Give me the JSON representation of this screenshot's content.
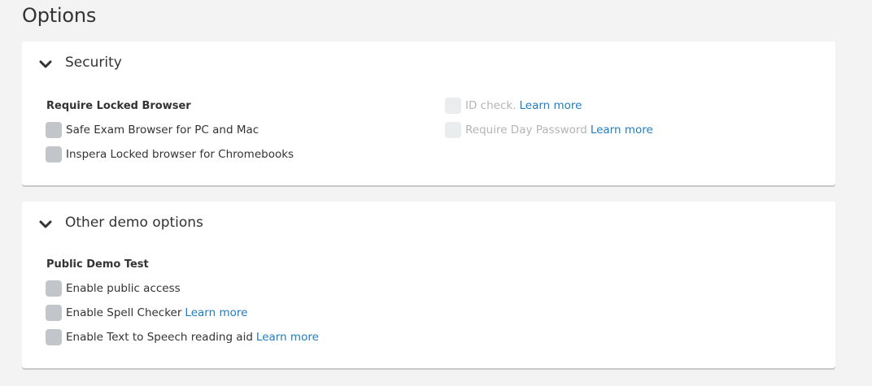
{
  "page": {
    "title": "Options"
  },
  "colors": {
    "link": "#1f7dbf",
    "checkbox": "#c2c6cb",
    "checkbox_disabled": "#ebecee"
  },
  "security": {
    "title": "Security",
    "group_label": "Require Locked Browser",
    "options": [
      {
        "label": "Safe Exam Browser for PC and Mac",
        "checked": false
      },
      {
        "label": "Inspera Locked browser for Chromebooks",
        "checked": false
      }
    ],
    "disabled_options": [
      {
        "label": "ID check.",
        "link": "Learn more",
        "checked": false
      },
      {
        "label": "Require Day Password",
        "link": "Learn more",
        "checked": false
      }
    ]
  },
  "demo": {
    "title": "Other demo options",
    "group_label": "Public Demo Test",
    "options": [
      {
        "label": "Enable public access",
        "checked": false
      },
      {
        "label": "Enable Spell Checker",
        "link": "Learn more",
        "checked": false
      },
      {
        "label": "Enable Text to Speech reading aid",
        "link": "Learn more",
        "checked": false
      }
    ]
  }
}
